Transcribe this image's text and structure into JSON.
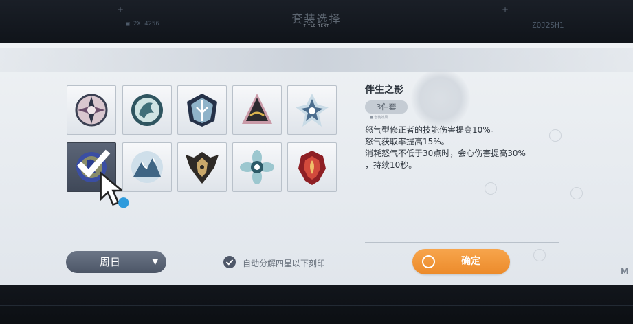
{
  "background": {
    "top_left_code": "▣ 2X 4256",
    "top_right_code": "ZQJ2SH1",
    "corner_mark": "M"
  },
  "dialog": {
    "title": "套装选择",
    "subtitle": "TITLE TEXT"
  },
  "sets": [
    {
      "name": "set-1",
      "icon": "pinwheel-emblem-icon",
      "selected": false
    },
    {
      "name": "set-2",
      "icon": "dragon-emblem-icon",
      "selected": false
    },
    {
      "name": "set-3",
      "icon": "tree-emblem-icon",
      "selected": false
    },
    {
      "name": "set-4",
      "icon": "witch-hat-emblem-icon",
      "selected": false
    },
    {
      "name": "set-5",
      "icon": "ice-crystal-emblem-icon",
      "selected": false
    },
    {
      "name": "set-6",
      "icon": "shadow-emblem-icon",
      "selected": true
    },
    {
      "name": "set-7",
      "icon": "mountain-emblem-icon",
      "selected": false
    },
    {
      "name": "set-8",
      "icon": "mask-emblem-icon",
      "selected": false
    },
    {
      "name": "set-9",
      "icon": "flower-emblem-icon",
      "selected": false
    },
    {
      "name": "set-10",
      "icon": "flame-emblem-icon",
      "selected": false
    }
  ],
  "detail": {
    "set_name": "伴生之影",
    "piece_badge": "3件套",
    "mini_label": "■ 套装效果",
    "description": [
      "怒气型修正者的技能伤害提高10%。",
      "怒气获取率提高15%。",
      "消耗怒气不低于30点时，会心伤害提高30%",
      "，持续10秒。"
    ]
  },
  "controls": {
    "day_select": {
      "value": "周日",
      "arrow": "▼"
    },
    "auto_decompose": {
      "label": "自动分解四星以下刻印",
      "checked": true
    },
    "confirm_label": "确定"
  },
  "colors": {
    "accent": "#f09432",
    "selected_slot": "#4f5869",
    "panel": "#e8ecf0"
  }
}
